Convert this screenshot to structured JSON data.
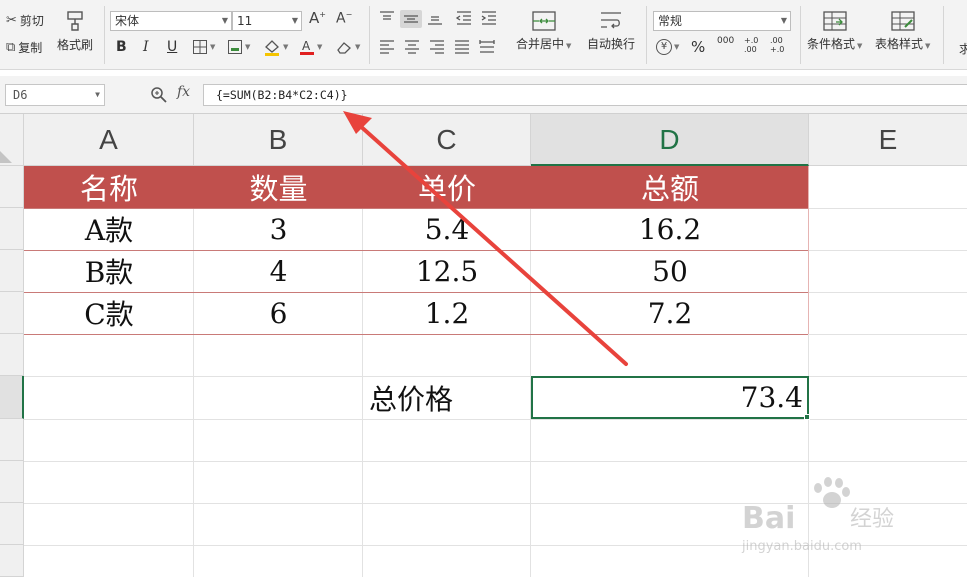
{
  "ribbon": {
    "cut": "剪切",
    "copy": "复制",
    "format_painter": "格式刷",
    "font_name": "宋体",
    "font_size": "11",
    "merge_center": "合并居中",
    "wrap_text": "自动换行",
    "number_format": "常规",
    "conditional_format": "条件格式",
    "table_style": "表格样式",
    "more_cut": "求",
    "bold": "B",
    "italic": "I",
    "underline": "U",
    "percent": "%",
    "thousands": "000",
    "inc_decimal": "+.0\n.00",
    "dec_decimal": ".00\n+.0"
  },
  "formula_bar": {
    "name_box": "D6",
    "fx": "fx",
    "formula": "{=SUM(B2:B4*C2:C4)}"
  },
  "columns": [
    "A",
    "B",
    "C",
    "D",
    "E"
  ],
  "table": {
    "headers": [
      "名称",
      "数量",
      "单价",
      "总额"
    ],
    "rows": [
      [
        "A款",
        "3",
        "5.4",
        "16.2"
      ],
      [
        "B款",
        "4",
        "12.5",
        "50"
      ],
      [
        "C款",
        "6",
        "1.2",
        "7.2"
      ]
    ]
  },
  "summary": {
    "label": "总价格",
    "value": "73.4"
  },
  "watermark": {
    "brand": "Bai",
    "brand_cn": "经验",
    "url": "jingyan.baidu.com"
  },
  "colors": {
    "header_fill": "#c0504d",
    "selection": "#217346",
    "arrow": "#e8433c"
  }
}
